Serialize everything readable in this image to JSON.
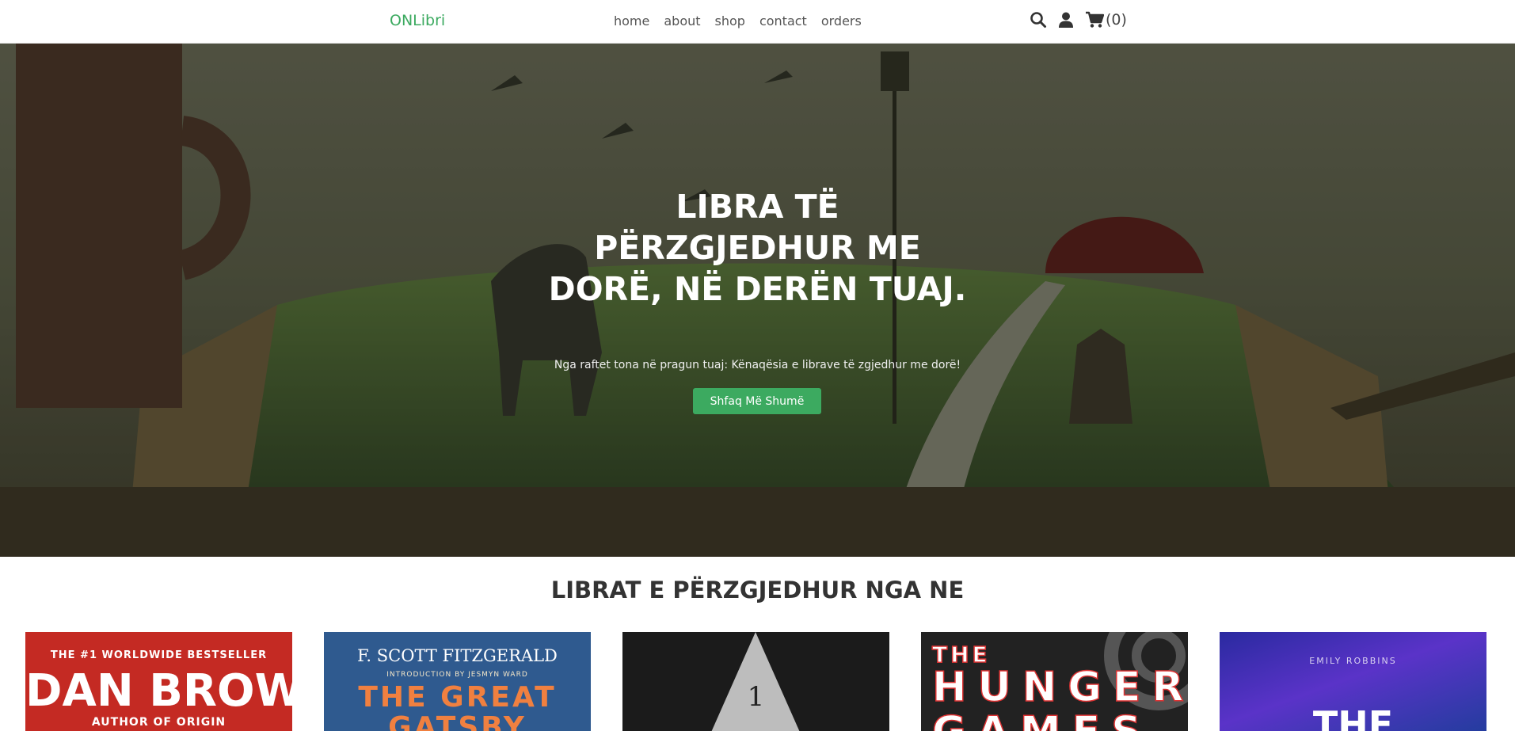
{
  "header": {
    "logo": "ONLibri",
    "nav": [
      "home",
      "about",
      "shop",
      "contact",
      "orders"
    ],
    "cart_count": "(0)",
    "icons": [
      "search-icon",
      "user-icon",
      "cart-icon"
    ]
  },
  "hero": {
    "title": "LIBRA TË PËRZGJEDHUR ME DORË, NË DERËN TUAJ.",
    "subtitle": "Nga raftet tona në pragun tuaj: Kënaqësia e librave të zgjedhur me dorë!",
    "button": "Shfaq Më Shumë"
  },
  "featured": {
    "title": "LIBRAT E PËRZGJEDHUR NGA NE",
    "books": [
      {
        "line1": "THE #1 WORLDWIDE BESTSELLER",
        "line2": "DAN BROWN",
        "line3": "AUTHOR OF ORIGIN"
      },
      {
        "line1": "F. SCOTT FITZGERALD",
        "line2": "INTRODUCTION BY JESMYN WARD",
        "line3": "THE GREAT",
        "line4": "GATSBY"
      },
      {
        "line1": "1"
      },
      {
        "line1": "THE",
        "line2": "HUNGER",
        "line3": "GAMES"
      },
      {
        "line1": "EMILY ROBBINS",
        "line2": "THE"
      }
    ]
  },
  "colors": {
    "accent": "#3caa60",
    "hero_overlay": "#1e2318"
  }
}
